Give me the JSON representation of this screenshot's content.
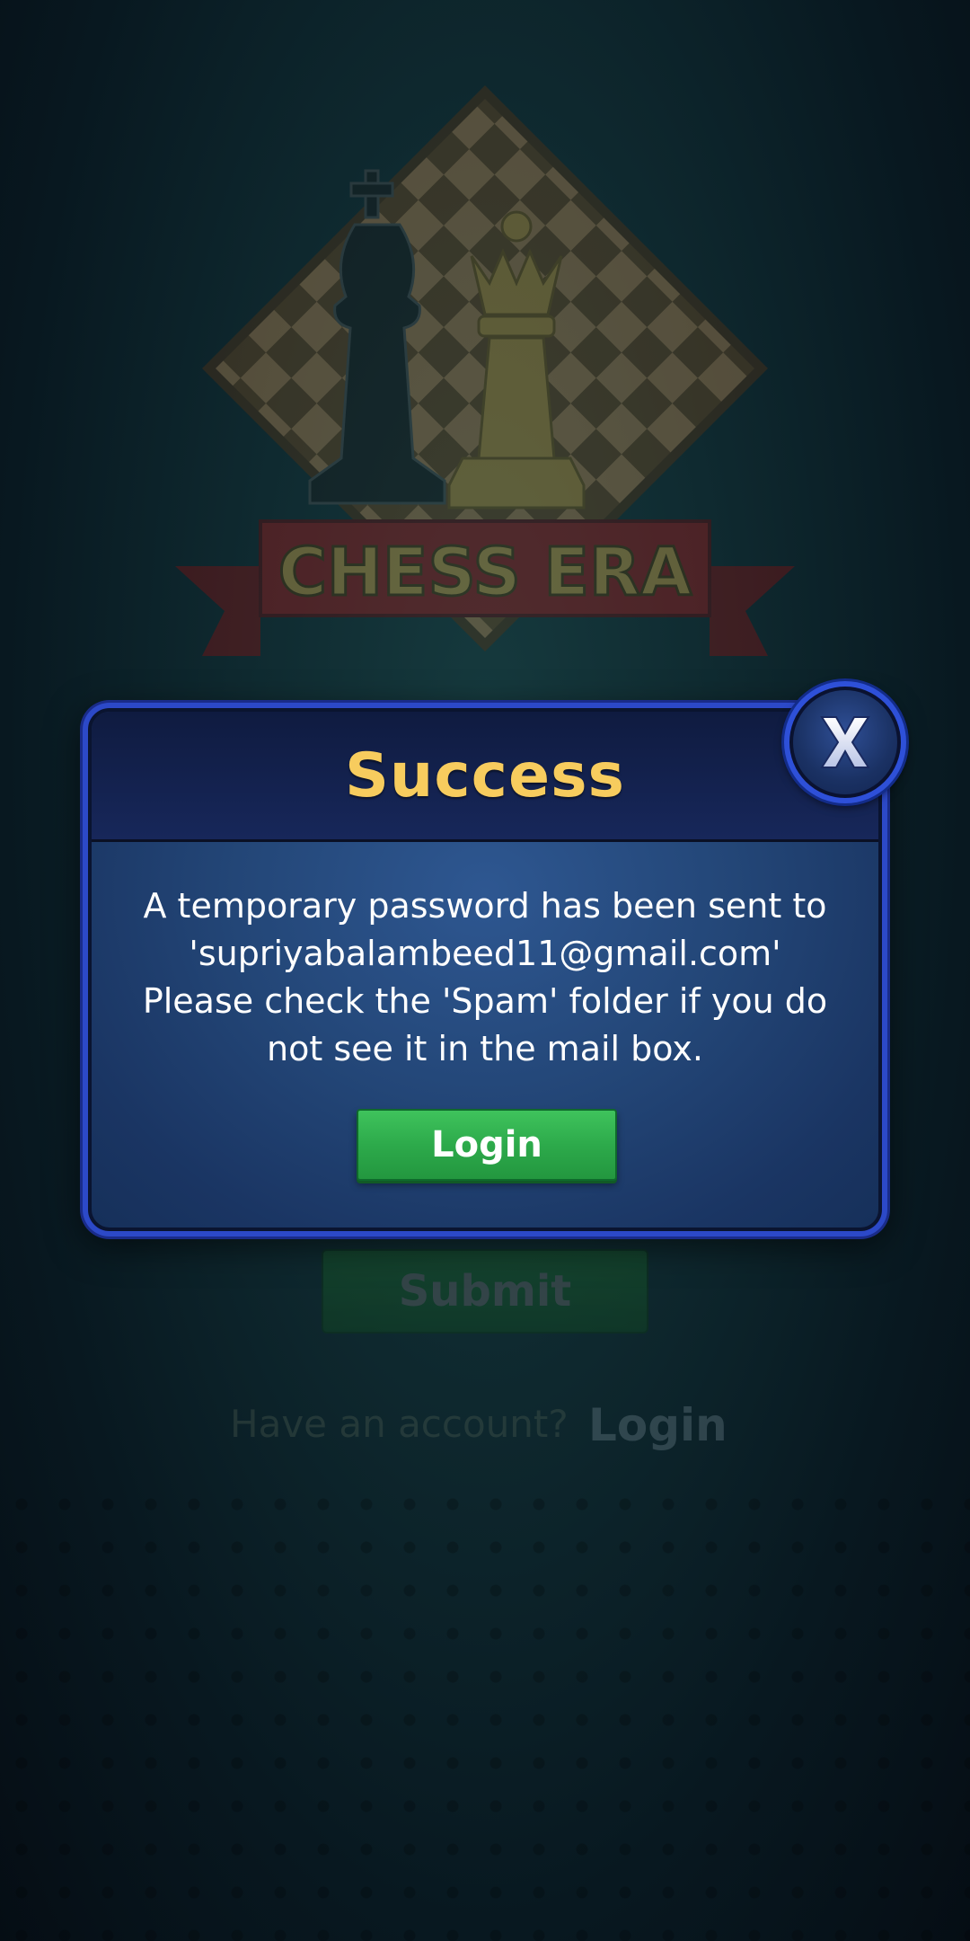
{
  "background": {
    "logo_text": "CHESS ERA",
    "submit_label": "Submit",
    "have_account_text": "Have an account?",
    "login_link_label": "Login"
  },
  "dialog": {
    "title": "Success",
    "message_lines": [
      "A temporary password has been sent to",
      "'supriyabalambeed11@gmail.com'",
      "Please check the 'Spam' folder if you do",
      "not see it in the mail box."
    ],
    "login_button_label": "Login",
    "close_icon": "close-x-icon"
  },
  "colors": {
    "title_gold": "#f7cc5e",
    "dialog_border": "#2c49c8",
    "button_green": "#2daa4b"
  }
}
